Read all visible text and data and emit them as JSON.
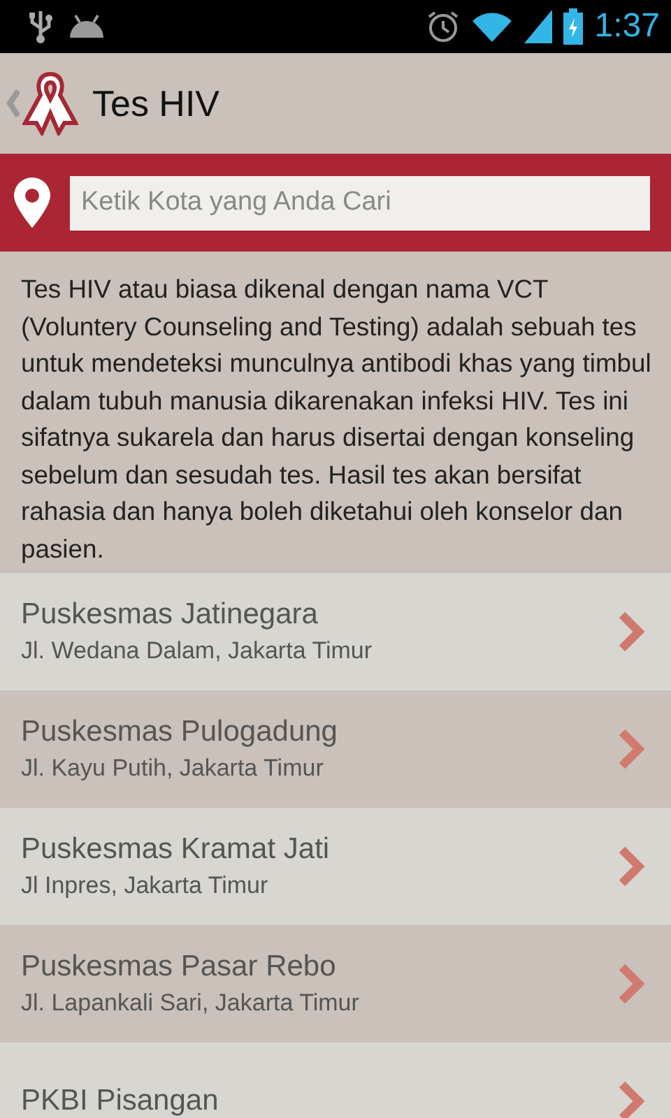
{
  "status_bar": {
    "time": "1:37"
  },
  "action_bar": {
    "title": "Tes HIV"
  },
  "search": {
    "placeholder": "Ketik Kota yang Anda Cari"
  },
  "description": "Tes HIV atau biasa dikenal dengan nama VCT (Voluntery Counseling and Testing) adalah sebuah tes untuk mendeteksi munculnya antibodi khas yang timbul dalam tubuh manusia dikarenakan infeksi HIV. Tes ini sifatnya sukarela dan harus disertai dengan konseling sebelum dan sesudah tes. Hasil tes akan bersifat rahasia dan hanya boleh diketahui oleh konselor dan pasien.",
  "places": [
    {
      "name": "Puskesmas Jatinegara",
      "address": "Jl. Wedana Dalam, Jakarta Timur"
    },
    {
      "name": "Puskesmas Pulogadung",
      "address": "Jl. Kayu Putih, Jakarta Timur"
    },
    {
      "name": "Puskesmas Kramat Jati",
      "address": "Jl Inpres, Jakarta Timur"
    },
    {
      "name": "Puskesmas Pasar Rebo",
      "address": "Jl. Lapankali Sari, Jakarta Timur"
    },
    {
      "name": "PKBI Pisangan"
    }
  ]
}
